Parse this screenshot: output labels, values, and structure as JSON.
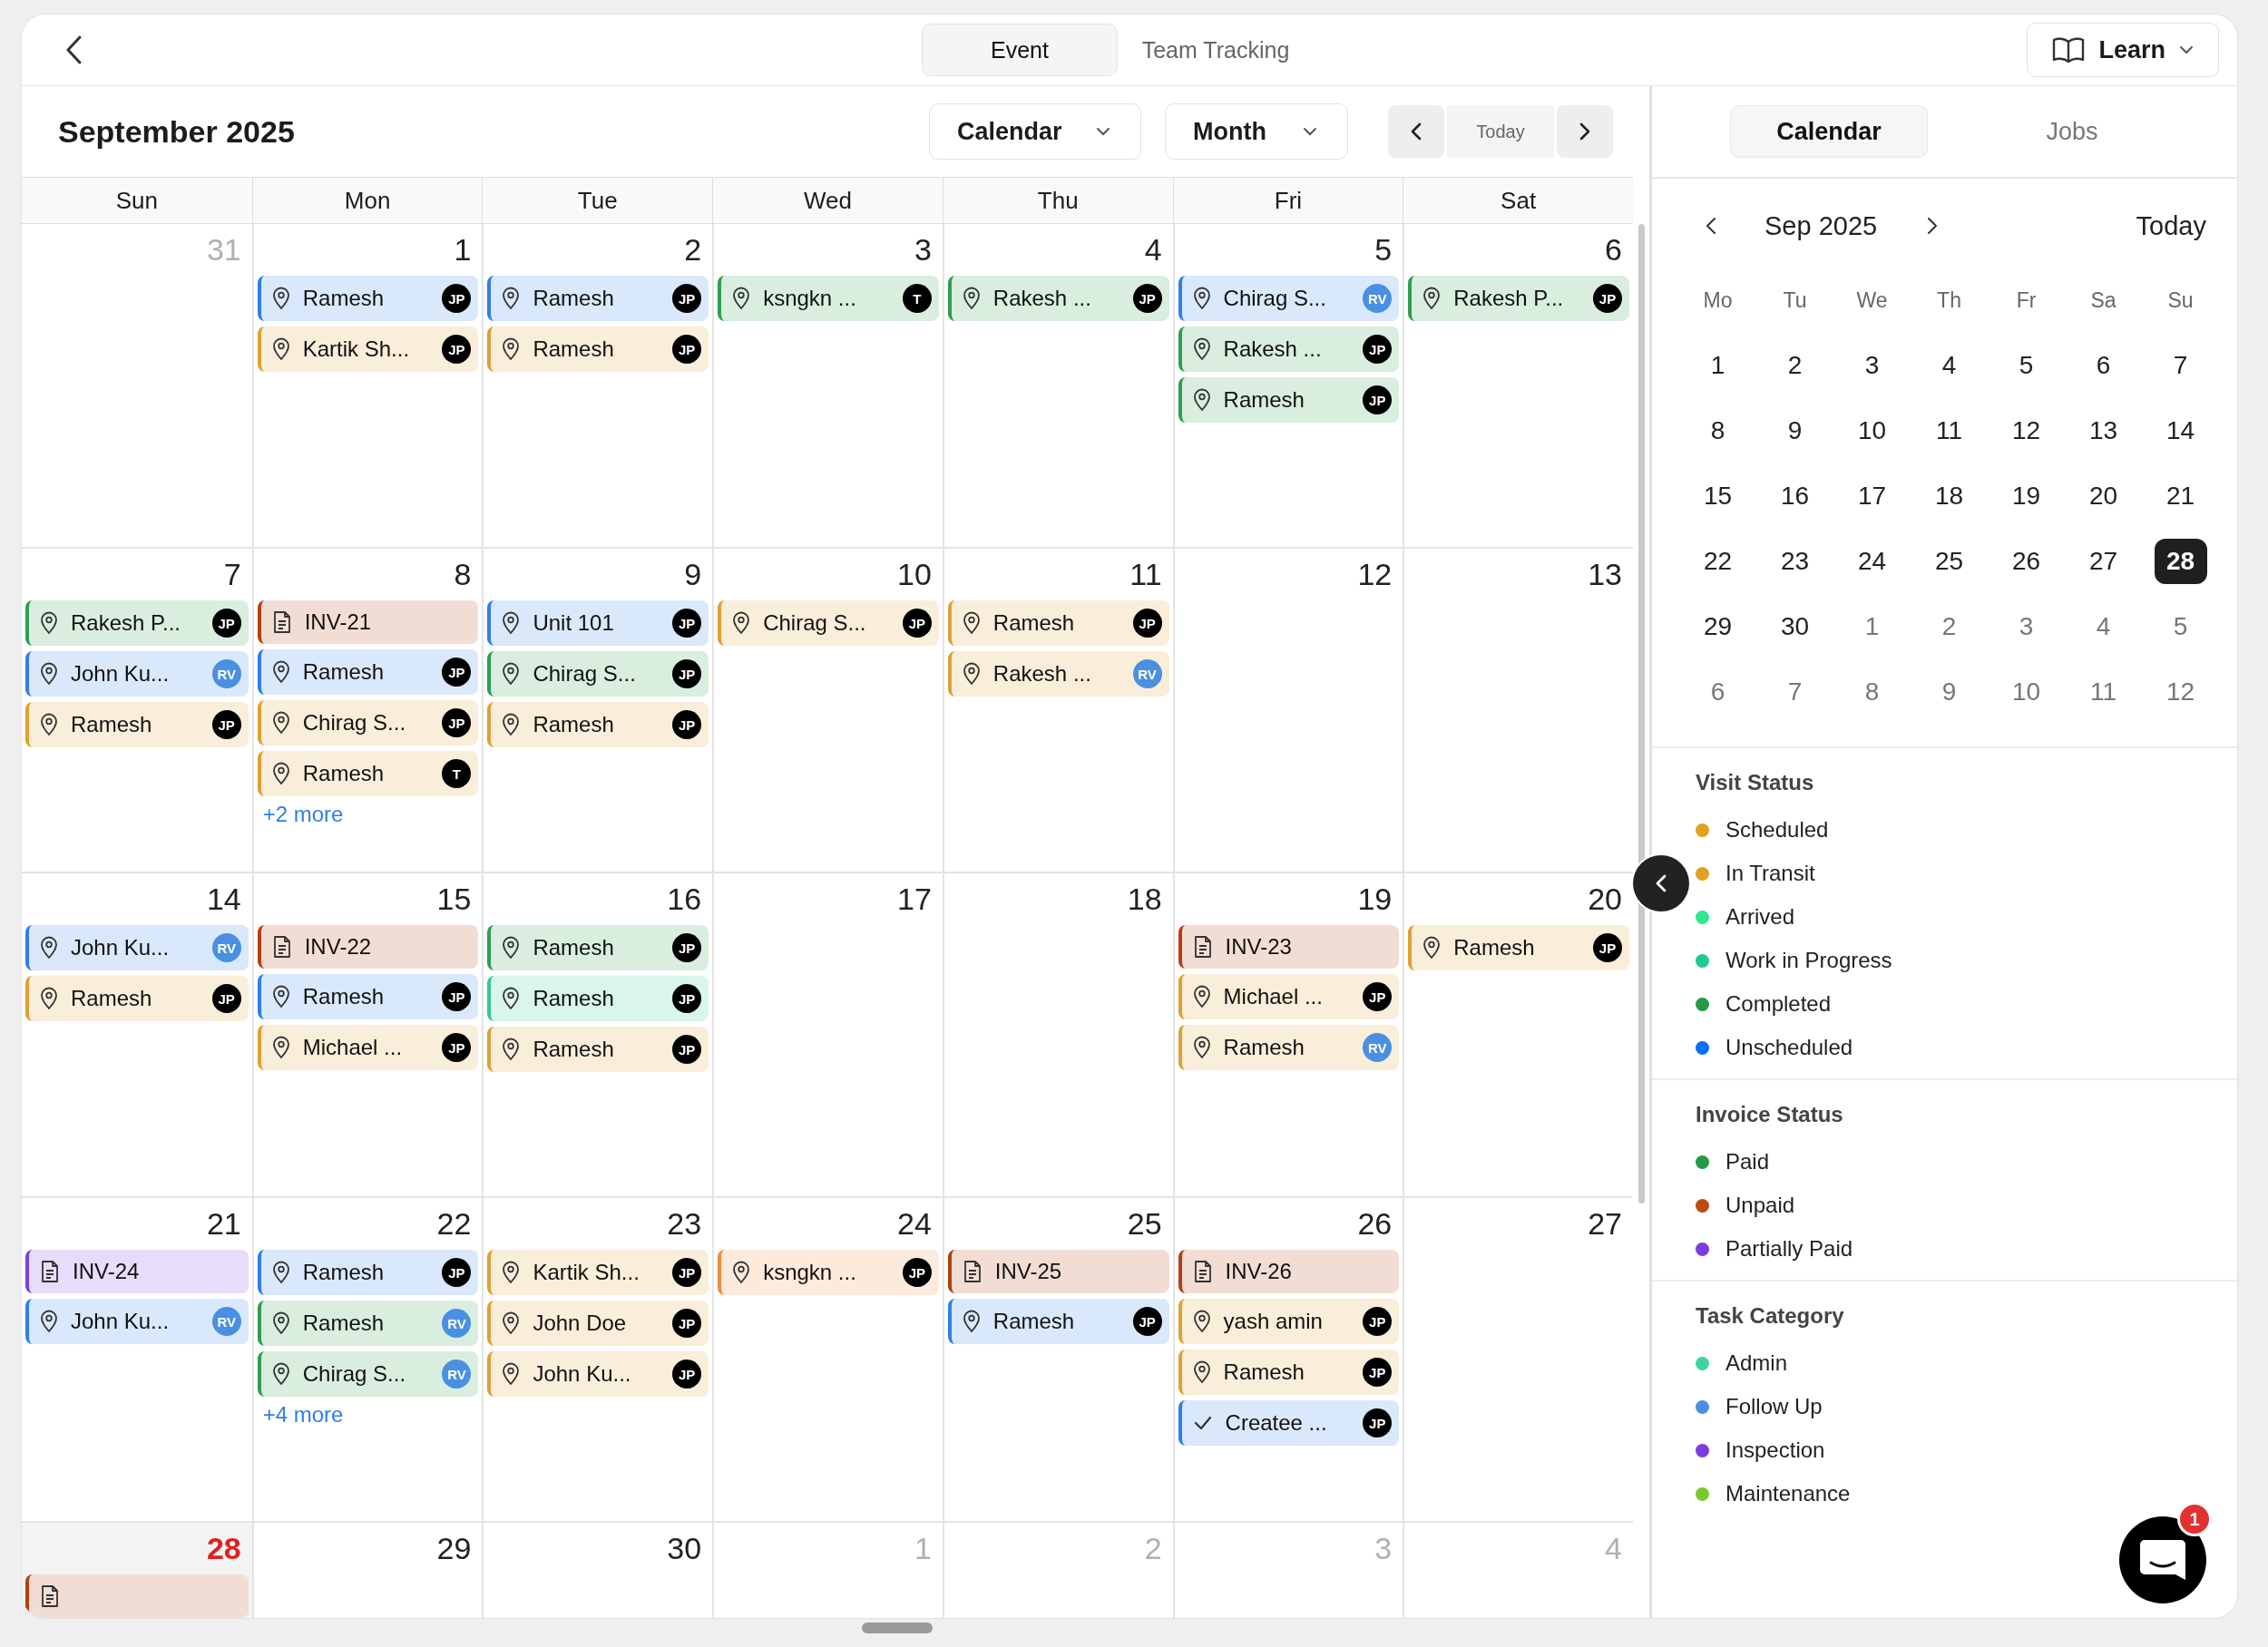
{
  "top_bar": {
    "tabs": [
      {
        "label": "Event",
        "selected": true
      },
      {
        "label": "Team Tracking",
        "selected": false
      }
    ],
    "learn_button": "Learn"
  },
  "calendar_header": {
    "title": "September 2025",
    "view_dropdown": "Calendar",
    "range_dropdown": "Month",
    "today_button": "Today"
  },
  "weekdays": [
    "Sun",
    "Mon",
    "Tue",
    "Wed",
    "Thu",
    "Fri",
    "Sat"
  ],
  "weeks": [
    [
      {
        "day": "31",
        "in_month": false,
        "today": false
      },
      {
        "day": "1",
        "in_month": true,
        "today": false,
        "events": [
          {
            "kind": "visit",
            "label": "Ramesh",
            "color": "#2f7fe8",
            "avatar": {
              "initials": "JP",
              "color": "#000000"
            }
          },
          {
            "kind": "visit",
            "label": "Kartik Sh...",
            "color": "#e0a030",
            "avatar": {
              "initials": "JP",
              "color": "#000000"
            }
          }
        ]
      },
      {
        "day": "2",
        "in_month": true,
        "today": false,
        "events": [
          {
            "kind": "visit",
            "label": "Ramesh",
            "color": "#2f7fe8",
            "avatar": {
              "initials": "JP",
              "color": "#000000"
            }
          },
          {
            "kind": "visit",
            "label": "Ramesh",
            "color": "#e0a030",
            "avatar": {
              "initials": "JP",
              "color": "#000000"
            }
          }
        ]
      },
      {
        "day": "3",
        "in_month": true,
        "today": false,
        "events": [
          {
            "kind": "visit",
            "label": "ksngkn ...",
            "color": "#2e9e4f",
            "avatar": {
              "initials": "T",
              "color": "#000000"
            }
          }
        ]
      },
      {
        "day": "4",
        "in_month": true,
        "today": false,
        "events": [
          {
            "kind": "visit",
            "label": "Rakesh ...",
            "color": "#2e9e4f",
            "avatar": {
              "initials": "JP",
              "color": "#000000"
            }
          }
        ]
      },
      {
        "day": "5",
        "in_month": true,
        "today": false,
        "events": [
          {
            "kind": "visit",
            "label": "Chirag S...",
            "color": "#2f7fe8",
            "avatar": {
              "initials": "RV",
              "color": "#4a90e2"
            }
          },
          {
            "kind": "visit",
            "label": "Rakesh ...",
            "color": "#2e9e4f",
            "avatar": {
              "initials": "JP",
              "color": "#000000"
            }
          },
          {
            "kind": "visit",
            "label": "Ramesh",
            "color": "#2e9e4f",
            "avatar": {
              "initials": "JP",
              "color": "#000000"
            }
          }
        ]
      },
      {
        "day": "6",
        "in_month": true,
        "today": false,
        "events": [
          {
            "kind": "visit",
            "label": "Rakesh P...",
            "color": "#2e9e4f",
            "avatar": {
              "initials": "JP",
              "color": "#000000"
            }
          }
        ]
      }
    ],
    [
      {
        "day": "7",
        "in_month": true,
        "today": false,
        "events": [
          {
            "kind": "visit",
            "label": "Rakesh P...",
            "color": "#2e9e4f",
            "avatar": {
              "initials": "JP",
              "color": "#000000"
            }
          },
          {
            "kind": "visit",
            "label": "John Ku...",
            "color": "#2f7fe8",
            "avatar": {
              "initials": "RV",
              "color": "#4a90e2"
            }
          },
          {
            "kind": "visit",
            "label": "Ramesh",
            "color": "#e0a030",
            "avatar": {
              "initials": "JP",
              "color": "#000000"
            }
          }
        ]
      },
      {
        "day": "8",
        "in_month": true,
        "today": false,
        "events": [
          {
            "kind": "invoice",
            "label": "INV-21",
            "color": "#b5400f"
          },
          {
            "kind": "visit",
            "label": "Ramesh",
            "color": "#2f7fe8",
            "avatar": {
              "initials": "JP",
              "color": "#000000"
            }
          },
          {
            "kind": "visit",
            "label": "Chirag S...",
            "color": "#e0a030",
            "avatar": {
              "initials": "JP",
              "color": "#000000"
            }
          },
          {
            "kind": "visit",
            "label": "Ramesh",
            "color": "#e0a030",
            "avatar": {
              "initials": "T",
              "color": "#000000"
            }
          }
        ],
        "more": "+2 more"
      },
      {
        "day": "9",
        "in_month": true,
        "today": false,
        "events": [
          {
            "kind": "visit",
            "label": "Unit 101",
            "color": "#2f7fe8",
            "avatar": {
              "initials": "JP",
              "color": "#000000"
            }
          },
          {
            "kind": "visit",
            "label": "Chirag S...",
            "color": "#2e9e4f",
            "avatar": {
              "initials": "JP",
              "color": "#000000"
            }
          },
          {
            "kind": "visit",
            "label": "Ramesh",
            "color": "#e0a030",
            "avatar": {
              "initials": "JP",
              "color": "#000000"
            }
          }
        ]
      },
      {
        "day": "10",
        "in_month": true,
        "today": false,
        "events": [
          {
            "kind": "visit",
            "label": "Chirag S...",
            "color": "#e0a030",
            "avatar": {
              "initials": "JP",
              "color": "#000000"
            }
          }
        ]
      },
      {
        "day": "11",
        "in_month": true,
        "today": false,
        "events": [
          {
            "kind": "visit",
            "label": "Ramesh",
            "color": "#e0a030",
            "avatar": {
              "initials": "JP",
              "color": "#000000"
            }
          },
          {
            "kind": "visit",
            "label": "Rakesh ...",
            "color": "#e0a030",
            "avatar": {
              "initials": "RV",
              "color": "#4a90e2"
            }
          }
        ]
      },
      {
        "day": "12",
        "in_month": true,
        "today": false
      },
      {
        "day": "13",
        "in_month": true,
        "today": false
      }
    ],
    [
      {
        "day": "14",
        "in_month": true,
        "today": false,
        "events": [
          {
            "kind": "visit",
            "label": "John Ku...",
            "color": "#2f7fe8",
            "avatar": {
              "initials": "RV",
              "color": "#4a90e2"
            }
          },
          {
            "kind": "visit",
            "label": "Ramesh",
            "color": "#e0a030",
            "avatar": {
              "initials": "JP",
              "color": "#000000"
            }
          }
        ]
      },
      {
        "day": "15",
        "in_month": true,
        "today": false,
        "events": [
          {
            "kind": "invoice",
            "label": "INV-22",
            "color": "#b5400f"
          },
          {
            "kind": "visit",
            "label": "Ramesh",
            "color": "#2f7fe8",
            "avatar": {
              "initials": "JP",
              "color": "#000000"
            }
          },
          {
            "kind": "visit",
            "label": "Michael ...",
            "color": "#e0a030",
            "avatar": {
              "initials": "JP",
              "color": "#000000"
            }
          }
        ]
      },
      {
        "day": "16",
        "in_month": true,
        "today": false,
        "events": [
          {
            "kind": "visit",
            "label": "Ramesh",
            "color": "#2e9e4f",
            "avatar": {
              "initials": "JP",
              "color": "#000000"
            }
          },
          {
            "kind": "visit",
            "label": "Ramesh",
            "color": "#2ec99b",
            "avatar": {
              "initials": "JP",
              "color": "#000000"
            }
          },
          {
            "kind": "visit",
            "label": "Ramesh",
            "color": "#e0a030",
            "avatar": {
              "initials": "JP",
              "color": "#000000"
            }
          }
        ]
      },
      {
        "day": "17",
        "in_month": true,
        "today": false
      },
      {
        "day": "18",
        "in_month": true,
        "today": false
      },
      {
        "day": "19",
        "in_month": true,
        "today": false,
        "events": [
          {
            "kind": "invoice",
            "label": "INV-23",
            "color": "#b5400f"
          },
          {
            "kind": "visit",
            "label": "Michael ...",
            "color": "#e0a030",
            "avatar": {
              "initials": "JP",
              "color": "#000000"
            }
          },
          {
            "kind": "visit",
            "label": "Ramesh",
            "color": "#e0a030",
            "avatar": {
              "initials": "RV",
              "color": "#4a90e2"
            }
          }
        ]
      },
      {
        "day": "20",
        "in_month": true,
        "today": false,
        "events": [
          {
            "kind": "visit",
            "label": "Ramesh",
            "color": "#e0a030",
            "avatar": {
              "initials": "JP",
              "color": "#000000"
            }
          }
        ]
      }
    ],
    [
      {
        "day": "21",
        "in_month": true,
        "today": false,
        "events": [
          {
            "kind": "invoice",
            "label": "INV-24",
            "color": "#7b3fe4"
          },
          {
            "kind": "visit",
            "label": "John Ku...",
            "color": "#2f7fe8",
            "avatar": {
              "initials": "RV",
              "color": "#4a90e2"
            }
          }
        ]
      },
      {
        "day": "22",
        "in_month": true,
        "today": false,
        "events": [
          {
            "kind": "visit",
            "label": "Ramesh",
            "color": "#2f7fe8",
            "avatar": {
              "initials": "JP",
              "color": "#000000"
            }
          },
          {
            "kind": "visit",
            "label": "Ramesh",
            "color": "#2e9e4f",
            "avatar": {
              "initials": "RV",
              "color": "#4a90e2"
            }
          },
          {
            "kind": "visit",
            "label": "Chirag S...",
            "color": "#2e9e4f",
            "avatar": {
              "initials": "RV",
              "color": "#4a90e2"
            }
          }
        ],
        "more": "+4 more"
      },
      {
        "day": "23",
        "in_month": true,
        "today": false,
        "events": [
          {
            "kind": "visit",
            "label": "Kartik Sh...",
            "color": "#e0a030",
            "avatar": {
              "initials": "JP",
              "color": "#000000"
            }
          },
          {
            "kind": "visit",
            "label": "John Doe",
            "color": "#e0a030",
            "avatar": {
              "initials": "JP",
              "color": "#000000"
            }
          },
          {
            "kind": "visit",
            "label": "John Ku...",
            "color": "#e0a030",
            "avatar": {
              "initials": "JP",
              "color": "#000000"
            }
          }
        ]
      },
      {
        "day": "24",
        "in_month": true,
        "today": false,
        "events": [
          {
            "kind": "visit",
            "label": "ksngkn ...",
            "color": "#ee8a3c",
            "avatar": {
              "initials": "JP",
              "color": "#000000"
            }
          }
        ]
      },
      {
        "day": "25",
        "in_month": true,
        "today": false,
        "events": [
          {
            "kind": "invoice",
            "label": "INV-25",
            "color": "#b5400f"
          },
          {
            "kind": "visit",
            "label": "Ramesh",
            "color": "#2f7fe8",
            "avatar": {
              "initials": "JP",
              "color": "#000000"
            }
          }
        ]
      },
      {
        "day": "26",
        "in_month": true,
        "today": false,
        "events": [
          {
            "kind": "invoice",
            "label": "INV-26",
            "color": "#b5400f"
          },
          {
            "kind": "visit",
            "label": "yash amin",
            "color": "#e0a030",
            "avatar": {
              "initials": "JP",
              "color": "#000000"
            }
          },
          {
            "kind": "visit",
            "label": "Ramesh",
            "color": "#e0a030",
            "avatar": {
              "initials": "JP",
              "color": "#000000"
            }
          },
          {
            "kind": "task",
            "label": "Createe ...",
            "color": "#2f7fe8",
            "avatar": {
              "initials": "JP",
              "color": "#000000"
            }
          }
        ]
      },
      {
        "day": "27",
        "in_month": true,
        "today": false
      }
    ],
    [
      {
        "day": "28",
        "in_month": true,
        "today": true,
        "events": [
          {
            "kind": "invoice",
            "color": "#b5400f"
          }
        ]
      },
      {
        "day": "29",
        "in_month": true,
        "today": false
      },
      {
        "day": "30",
        "in_month": true,
        "today": false
      },
      {
        "day": "1",
        "in_month": false,
        "today": false
      },
      {
        "day": "2",
        "in_month": false,
        "today": false
      },
      {
        "day": "3",
        "in_month": false,
        "today": false
      },
      {
        "day": "4",
        "in_month": false,
        "today": false
      }
    ]
  ],
  "side_panel": {
    "tabs": [
      {
        "label": "Calendar",
        "selected": true
      },
      {
        "label": "Jobs",
        "selected": false
      }
    ],
    "mini_calendar": {
      "month": "Sep 2025",
      "today_button": "Today",
      "weekdays": [
        "Mo",
        "Tu",
        "We",
        "Th",
        "Fr",
        "Sa",
        "Su"
      ],
      "days": [
        {
          "label": "1",
          "in_month": true,
          "selected": false
        },
        {
          "label": "2",
          "in_month": true,
          "selected": false
        },
        {
          "label": "3",
          "in_month": true,
          "selected": false
        },
        {
          "label": "4",
          "in_month": true,
          "selected": false
        },
        {
          "label": "5",
          "in_month": true,
          "selected": false
        },
        {
          "label": "6",
          "in_month": true,
          "selected": false
        },
        {
          "label": "7",
          "in_month": true,
          "selected": false
        },
        {
          "label": "8",
          "in_month": true,
          "selected": false
        },
        {
          "label": "9",
          "in_month": true,
          "selected": false
        },
        {
          "label": "10",
          "in_month": true,
          "selected": false
        },
        {
          "label": "11",
          "in_month": true,
          "selected": false
        },
        {
          "label": "12",
          "in_month": true,
          "selected": false
        },
        {
          "label": "13",
          "in_month": true,
          "selected": false
        },
        {
          "label": "14",
          "in_month": true,
          "selected": false
        },
        {
          "label": "15",
          "in_month": true,
          "selected": false
        },
        {
          "label": "16",
          "in_month": true,
          "selected": false
        },
        {
          "label": "17",
          "in_month": true,
          "selected": false
        },
        {
          "label": "18",
          "in_month": true,
          "selected": false
        },
        {
          "label": "19",
          "in_month": true,
          "selected": false
        },
        {
          "label": "20",
          "in_month": true,
          "selected": false
        },
        {
          "label": "21",
          "in_month": true,
          "selected": false
        },
        {
          "label": "22",
          "in_month": true,
          "selected": false
        },
        {
          "label": "23",
          "in_month": true,
          "selected": false
        },
        {
          "label": "24",
          "in_month": true,
          "selected": false
        },
        {
          "label": "25",
          "in_month": true,
          "selected": false
        },
        {
          "label": "26",
          "in_month": true,
          "selected": false
        },
        {
          "label": "27",
          "in_month": true,
          "selected": false
        },
        {
          "label": "28",
          "in_month": true,
          "selected": true
        },
        {
          "label": "29",
          "in_month": true,
          "selected": false
        },
        {
          "label": "30",
          "in_month": true,
          "selected": false
        },
        {
          "label": "1",
          "in_month": false,
          "selected": false
        },
        {
          "label": "2",
          "in_month": false,
          "selected": false
        },
        {
          "label": "3",
          "in_month": false,
          "selected": false
        },
        {
          "label": "4",
          "in_month": false,
          "selected": false
        },
        {
          "label": "5",
          "in_month": false,
          "selected": false
        },
        {
          "label": "6",
          "in_month": false,
          "selected": false
        },
        {
          "label": "7",
          "in_month": false,
          "selected": false
        },
        {
          "label": "8",
          "in_month": false,
          "selected": false
        },
        {
          "label": "9",
          "in_month": false,
          "selected": false
        },
        {
          "label": "10",
          "in_month": false,
          "selected": false
        },
        {
          "label": "11",
          "in_month": false,
          "selected": false
        },
        {
          "label": "12",
          "in_month": false,
          "selected": false
        }
      ]
    },
    "legends": [
      {
        "title": "Visit Status",
        "items": [
          {
            "label": "Scheduled",
            "color": "#e3a020"
          },
          {
            "label": "In Transit",
            "color": "#e3a020"
          },
          {
            "label": "Arrived",
            "color": "#2ee88a"
          },
          {
            "label": "Work in Progress",
            "color": "#22c894"
          },
          {
            "label": "Completed",
            "color": "#249a44"
          },
          {
            "label": "Unscheduled",
            "color": "#0a6ff5"
          }
        ]
      },
      {
        "title": "Invoice Status",
        "items": [
          {
            "label": "Paid",
            "color": "#249a44"
          },
          {
            "label": "Unpaid",
            "color": "#c04a0c"
          },
          {
            "label": "Partially Paid",
            "color": "#7a3ee0"
          }
        ]
      },
      {
        "title": "Task Category",
        "items": [
          {
            "label": "Admin",
            "color": "#3fd3a0"
          },
          {
            "label": "Follow Up",
            "color": "#4a90e2"
          },
          {
            "label": "Inspection",
            "color": "#7a3ee0"
          },
          {
            "label": "Maintenance",
            "color": "#7cc72e"
          }
        ]
      }
    ],
    "chat": {
      "badge": "1"
    }
  }
}
